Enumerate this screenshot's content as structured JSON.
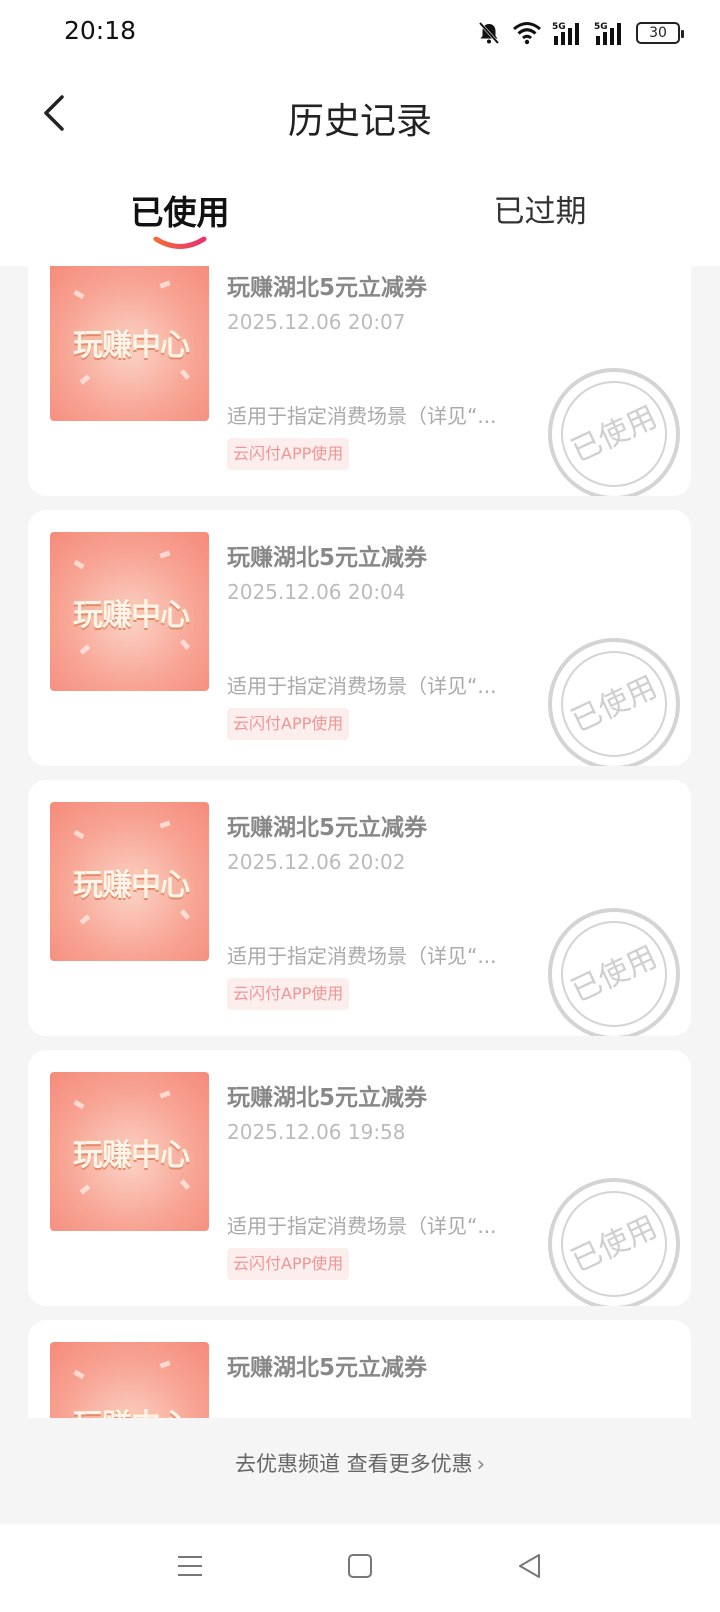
{
  "status_bar": {
    "time": "20:18",
    "battery": "30",
    "icons": [
      "mute-bell-icon",
      "wifi-icon",
      "signal-5g-icon",
      "signal-5g-icon",
      "battery-icon"
    ]
  },
  "header": {
    "title": "历史记录",
    "back_icon": "chevron-left-icon"
  },
  "tabs": [
    {
      "label": "已使用",
      "active": true
    },
    {
      "label": "已过期",
      "active": false
    }
  ],
  "coupons": [
    {
      "image_text": "玩赚中心",
      "title": "玩赚湖北5元立减券",
      "time": "2025.12.06 20:07",
      "desc": "适用于指定消费场景（详见“...",
      "tag": "云闪付APP使用",
      "stamp": "已使用"
    },
    {
      "image_text": "玩赚中心",
      "title": "玩赚湖北5元立减券",
      "time": "2025.12.06 20:04",
      "desc": "适用于指定消费场景（详见“...",
      "tag": "云闪付APP使用",
      "stamp": "已使用"
    },
    {
      "image_text": "玩赚中心",
      "title": "玩赚湖北5元立减券",
      "time": "2025.12.06 20:02",
      "desc": "适用于指定消费场景（详见“...",
      "tag": "云闪付APP使用",
      "stamp": "已使用"
    },
    {
      "image_text": "玩赚中心",
      "title": "玩赚湖北5元立减券",
      "time": "2025.12.06 19:58",
      "desc": "适用于指定消费场景（详见“...",
      "tag": "云闪付APP使用",
      "stamp": "已使用"
    },
    {
      "image_text": "玩赚中心",
      "title": "玩赚湖北5元立减券"
    }
  ],
  "footer": {
    "link_text": "去优惠频道 查看更多优惠",
    "chevron": "›"
  },
  "nav_bar": {
    "icons": [
      "menu-icon",
      "home-square-icon",
      "back-triangle-icon"
    ]
  },
  "colors": {
    "accent": "#e8453c",
    "tag_bg": "#fdeeee",
    "tag_text": "#f19595"
  }
}
